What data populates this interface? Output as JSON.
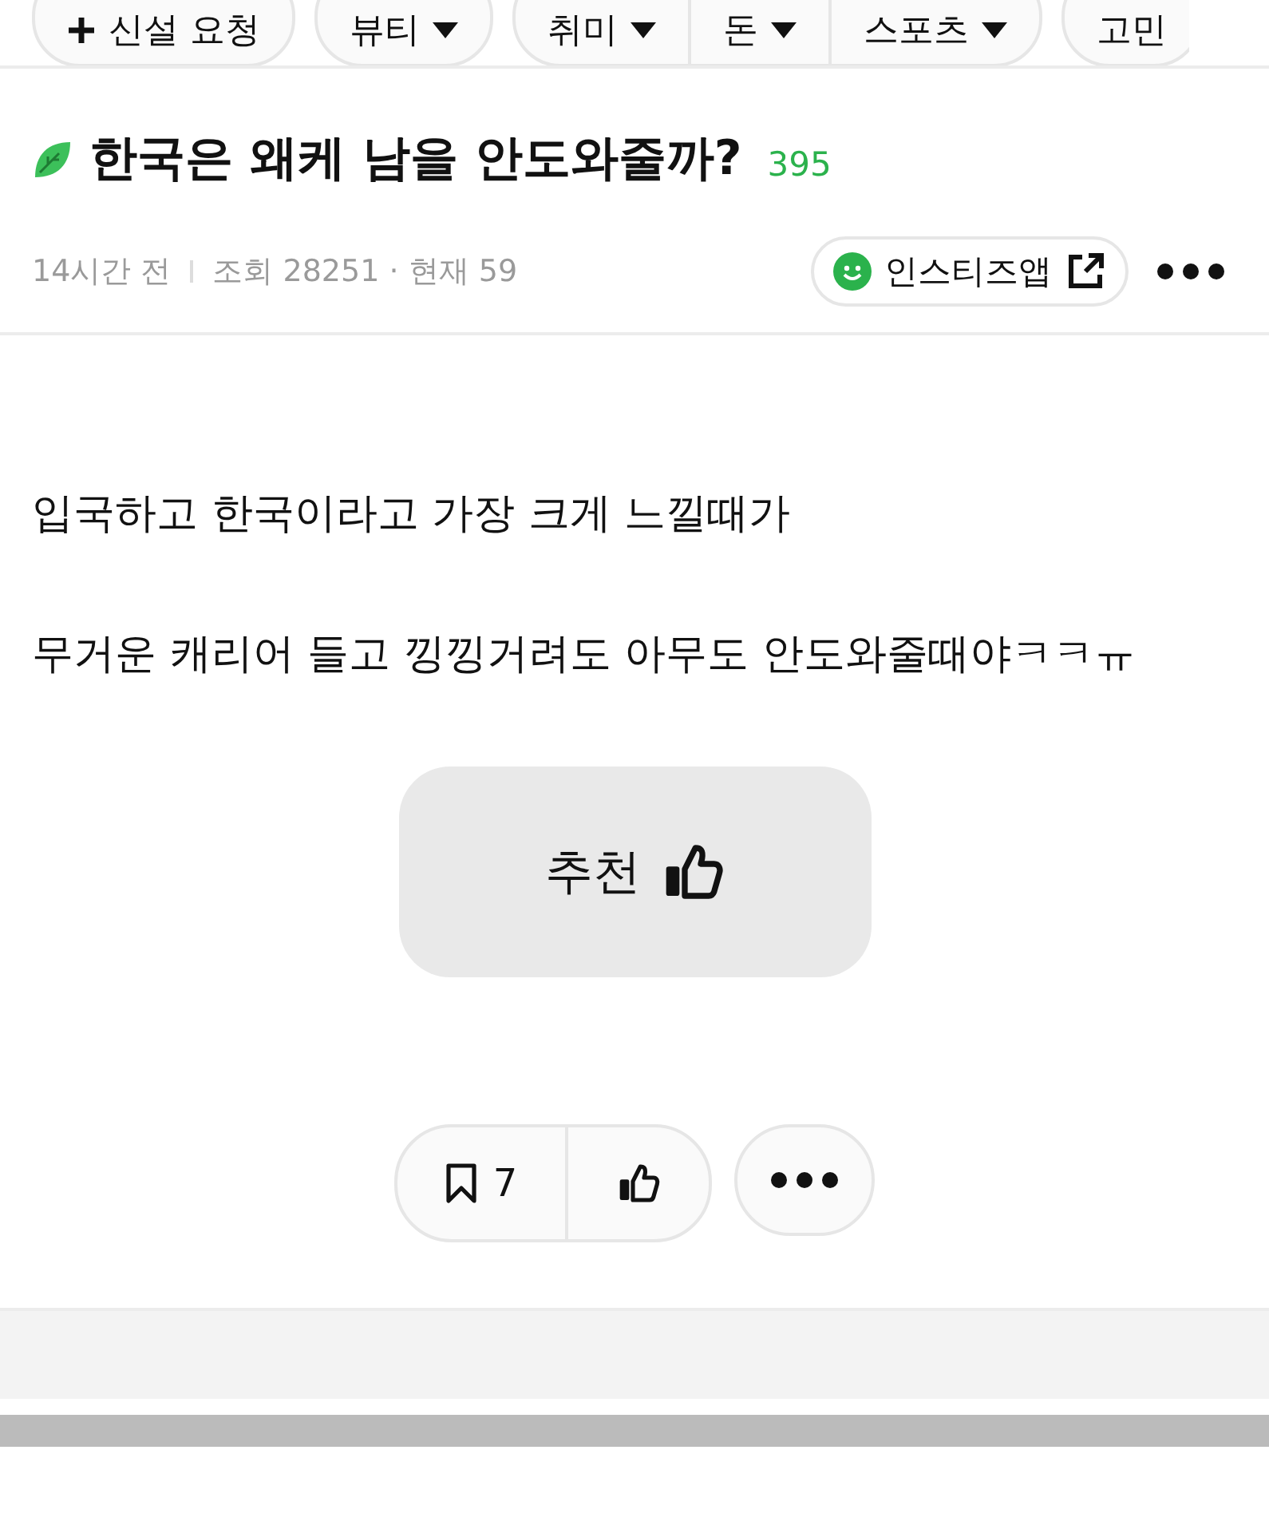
{
  "category_chips": [
    {
      "items": [
        {
          "label": "신설 요청",
          "kind": "add"
        }
      ]
    },
    {
      "items": [
        {
          "label": "뷰티",
          "kind": "dropdown"
        }
      ]
    },
    {
      "items": [
        {
          "label": "취미",
          "kind": "dropdown"
        },
        {
          "label": "돈",
          "kind": "dropdown"
        },
        {
          "label": "스포츠",
          "kind": "dropdown"
        }
      ]
    },
    {
      "items": [
        {
          "label": "고민",
          "kind": "plain"
        }
      ]
    }
  ],
  "post": {
    "title": "한국은 왜케 남을 안도와줄까?",
    "comment_count": "395",
    "time": "14시간 전",
    "views": "조회 28251 · 현재 59",
    "source": "인스티즈앱",
    "body": [
      "입국하고 한국이라고 가장 크게 느낄때가",
      "무거운 캐리어 들고 낑낑거려도 아무도 안도와줄때야ㅋㅋㅠ"
    ],
    "recommend_label": "추천",
    "bookmark_count": "7"
  }
}
